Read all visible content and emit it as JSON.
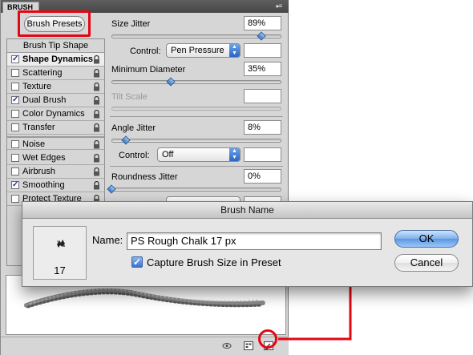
{
  "panel": {
    "tab_label": "BRUSH",
    "menu_glyph": "▸≡",
    "brush_presets_label": "Brush Presets",
    "category_header": "Brush Tip Shape",
    "categories": [
      {
        "label": "Shape Dynamics",
        "checked": true,
        "selected": true
      },
      {
        "label": "Scattering",
        "checked": false
      },
      {
        "label": "Texture",
        "checked": false
      },
      {
        "label": "Dual Brush",
        "checked": true
      },
      {
        "label": "Color Dynamics",
        "checked": false
      },
      {
        "label": "Transfer",
        "checked": false
      },
      {
        "label": "Noise",
        "checked": false
      },
      {
        "label": "Wet Edges",
        "checked": false
      },
      {
        "label": "Airbrush",
        "checked": false
      },
      {
        "label": "Smoothing",
        "checked": true
      },
      {
        "label": "Protect Texture",
        "checked": false
      }
    ],
    "check_glyph": "✓",
    "size_jitter": {
      "label": "Size Jitter",
      "value": "89%",
      "level": 0.89
    },
    "control_1": {
      "label": "Control:",
      "selected": "Pen Pressure",
      "value": ""
    },
    "minimum_diameter": {
      "label": "Minimum Diameter",
      "value": "35%",
      "level": 0.35
    },
    "tilt_scale": {
      "label": "Tilt Scale",
      "value": ""
    },
    "angle_jitter": {
      "label": "Angle Jitter",
      "value": "8%",
      "level": 0.08
    },
    "control_2": {
      "label": "Control:",
      "selected": "Off",
      "value": ""
    },
    "roundness_jitter": {
      "label": "Roundness Jitter",
      "value": "0%",
      "level": 0.0
    }
  },
  "dialog": {
    "title": "Brush Name",
    "preview_size": "17",
    "name_label": "Name:",
    "name_value": "PS Rough Chalk 17 px",
    "capture_label": "Capture Brush Size in Preset",
    "capture_checked": true,
    "ok_label": "OK",
    "cancel_label": "Cancel"
  },
  "colors": {
    "highlight_red": "#e30613",
    "panel_bg": "#d6d6d6",
    "accent_blue": "#3c7bc9"
  }
}
